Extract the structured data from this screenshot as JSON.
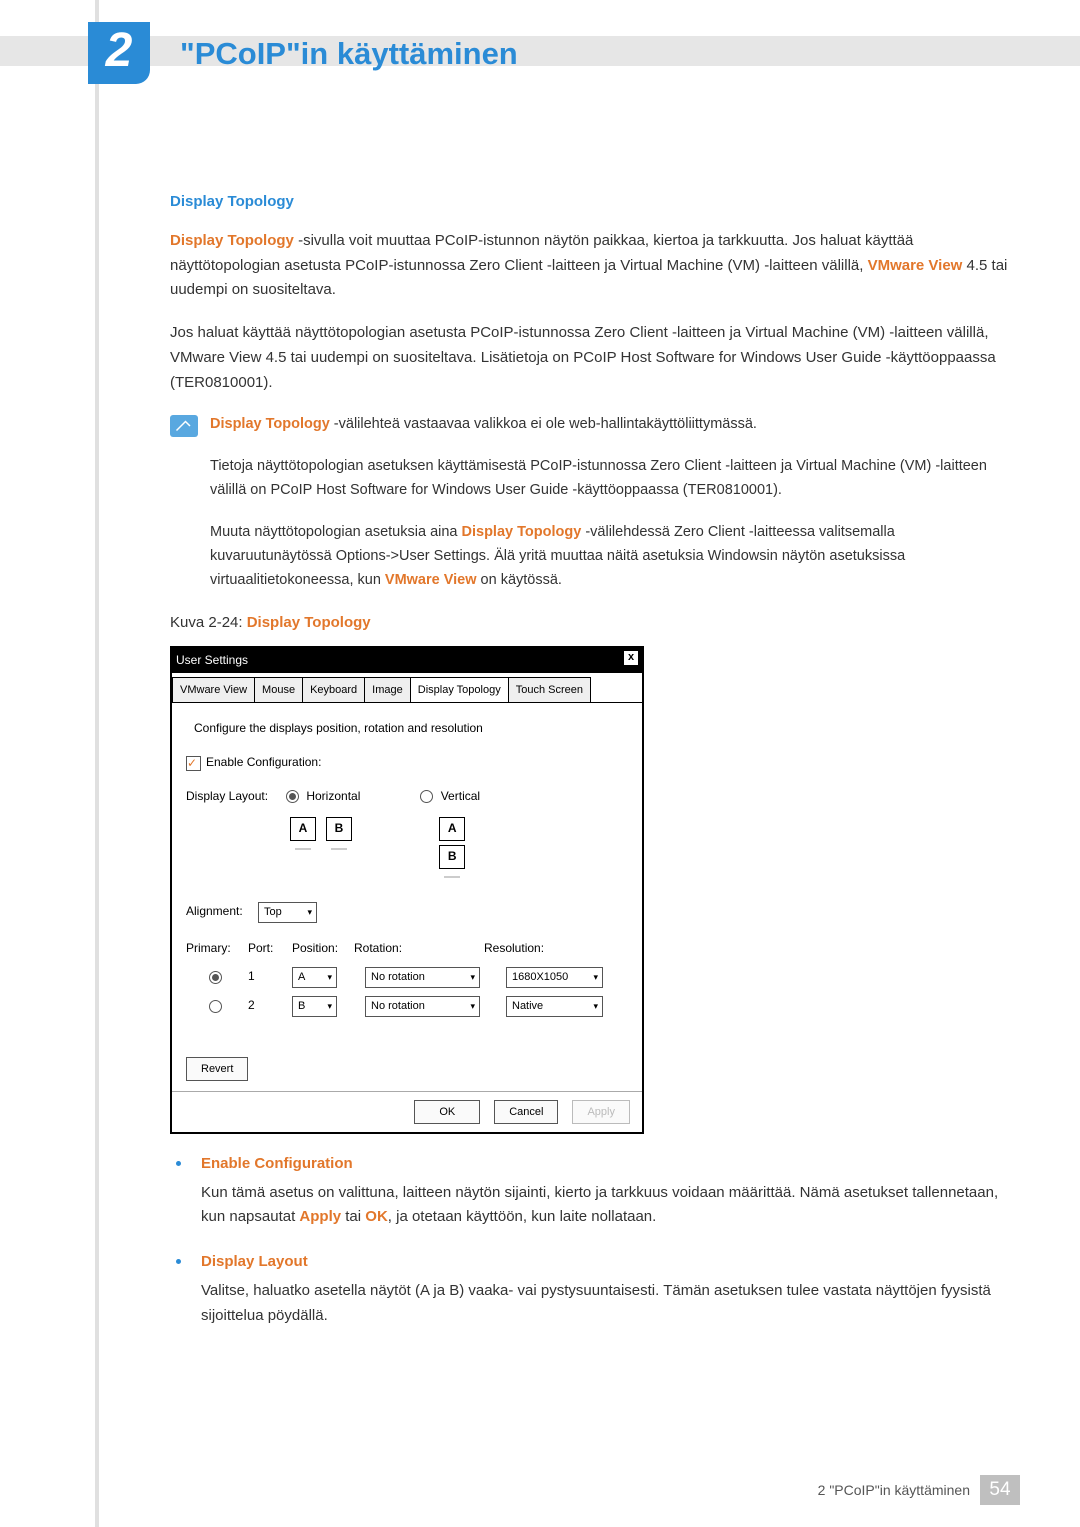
{
  "chapter": {
    "number": "2",
    "title": "\"PCoIP\"in käyttäminen"
  },
  "section": {
    "heading": "Display Topology",
    "p1_a": "Display Topology",
    "p1_b": " -sivulla voit muuttaa PCoIP-istunnon näytön paikkaa, kiertoa ja tarkkuutta. Jos haluat käyttää näyttötopologian asetusta PCoIP-istunnossa Zero Client -laitteen ja Virtual Machine (VM) -laitteen välillä, ",
    "p1_c": "VMware View",
    "p1_d": " 4.5 tai uudempi on suositeltava.",
    "p2": "Jos haluat käyttää näyttötopologian asetusta PCoIP-istunnossa Zero Client -laitteen ja Virtual Machine (VM) -laitteen välillä, VMware View 4.5 tai uudempi on suositeltava. Lisätietoja on PCoIP Host Software for Windows User Guide -käyttöoppaassa (TER0810001)."
  },
  "note": {
    "n1_a": "Display Topology",
    "n1_b": " -välilehteä vastaavaa valikkoa ei ole web-hallintakäyttöliittymässä.",
    "n2": "Tietoja näyttötopologian asetuksen käyttämisestä PCoIP-istunnossa Zero Client -laitteen ja Virtual Machine (VM) -laitteen välillä on PCoIP Host Software for Windows User Guide -käyttöoppaassa (TER0810001).",
    "n3_a": "Muuta näyttötopologian asetuksia aina ",
    "n3_b": "Display Topology",
    "n3_c": " -välilehdessä Zero Client -laitteessa valitsemalla kuvaruutunäytössä Options->User Settings. Älä yritä muuttaa näitä asetuksia Windowsin näytön asetuksissa virtuaalitietokoneessa, kun ",
    "n3_d": "VMware View",
    "n3_e": " on käytössä."
  },
  "figure": {
    "caption_a": "Kuva 2-24: ",
    "caption_b": "Display Topology"
  },
  "dialog": {
    "title": "User Settings",
    "tabs": [
      "VMware View",
      "Mouse",
      "Keyboard",
      "Image",
      "Display Topology",
      "Touch Screen"
    ],
    "active_tab": 4,
    "instruction": "Configure the displays position, rotation and resolution",
    "enable_label": "Enable Configuration:",
    "layout_label": "Display Layout:",
    "option_horizontal": "Horizontal",
    "option_vertical": "Vertical",
    "label_A": "A",
    "label_B": "B",
    "alignment_label": "Alignment:",
    "alignment_value": "Top",
    "col_primary": "Primary:",
    "col_port": "Port:",
    "col_position": "Position:",
    "col_rotation": "Rotation:",
    "col_resolution": "Resolution:",
    "rows": [
      {
        "primary": true,
        "port": "1",
        "position": "A",
        "rotation": "No rotation",
        "resolution": "1680X1050"
      },
      {
        "primary": false,
        "port": "2",
        "position": "B",
        "rotation": "No rotation",
        "resolution": "Native"
      }
    ],
    "revert": "Revert",
    "ok": "OK",
    "cancel": "Cancel",
    "apply": "Apply"
  },
  "bullets": {
    "b1_title": "Enable Configuration",
    "b1_body_a": "Kun tämä asetus on valittuna, laitteen näytön sijainti, kierto ja tarkkuus voidaan määrittää. Nämä asetukset tallennetaan, kun napsautat ",
    "b1_body_b": "Apply",
    "b1_body_c": " tai ",
    "b1_body_d": "OK",
    "b1_body_e": ", ja otetaan käyttöön, kun laite nollataan.",
    "b2_title": "Display Layout",
    "b2_body": "Valitse, haluatko asetella näytöt (A ja B) vaaka- vai pystysuuntaisesti. Tämän asetuksen tulee vastata näyttöjen fyysistä sijoittelua pöydällä."
  },
  "footer": {
    "label": "2 \"PCoIP\"in käyttäminen",
    "page": "54"
  }
}
